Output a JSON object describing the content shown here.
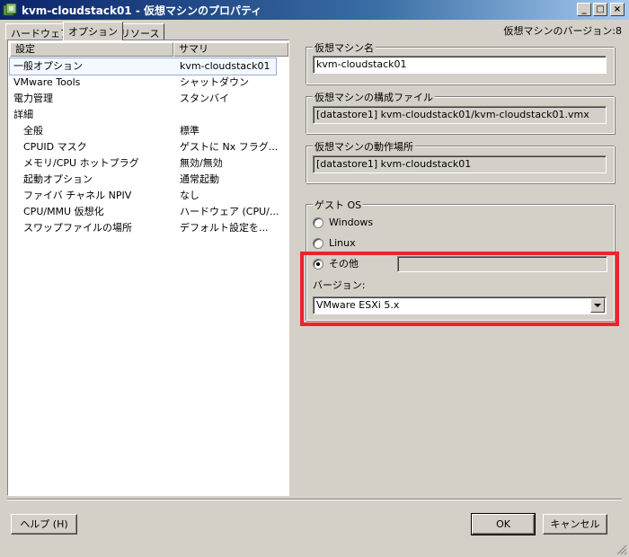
{
  "window": {
    "title": "kvm-cloudstack01 - 仮想マシンのプロパティ",
    "controls": {
      "minimize": "_",
      "maximize": "□",
      "close": "×"
    }
  },
  "tabs": [
    {
      "label": "ハードウェア",
      "active": false
    },
    {
      "label": "オプション",
      "active": true
    },
    {
      "label": "リソース",
      "active": false
    }
  ],
  "version_label": "仮想マシンのバージョン:8",
  "options_list": {
    "columns": [
      "設定",
      "サマリ"
    ],
    "items": [
      {
        "label": "一般オプション",
        "value": "kvm-cloudstack01",
        "selected": true
      },
      {
        "label": "VMware Tools",
        "value": "シャットダウン"
      },
      {
        "label": "電力管理",
        "value": "スタンバイ"
      },
      {
        "label": "詳細",
        "value": ""
      },
      {
        "label": "全般",
        "value": "標準"
      },
      {
        "label": "CPUID マスク",
        "value": "ゲストに Nx フラグ..."
      },
      {
        "label": "メモリ/CPU ホットプラグ",
        "value": "無効/無効"
      },
      {
        "label": "起動オプション",
        "value": "通常起動"
      },
      {
        "label": "ファイバ チャネル NPIV",
        "value": "なし"
      },
      {
        "label": "CPU/MMU 仮想化",
        "value": "ハードウェア (CPU/..."
      },
      {
        "label": "スワップファイルの場所",
        "value": "デフォルト設定を..."
      }
    ]
  },
  "vm_name": {
    "title": "仮想マシン名",
    "value": "kvm-cloudstack01"
  },
  "config_file": {
    "title": "仮想マシンの構成ファイル",
    "value": "[datastore1] kvm-cloudstack01/kvm-cloudstack01.vmx"
  },
  "working_location": {
    "title": "仮想マシンの動作場所",
    "value": "[datastore1] kvm-cloudstack01"
  },
  "guest_os": {
    "title": "ゲスト OS",
    "options": [
      {
        "label": "Windows",
        "checked": false
      },
      {
        "label": "Linux",
        "checked": false
      },
      {
        "label": "その他",
        "checked": true
      }
    ],
    "version_label": "バージョン:",
    "version_value": "VMware ESXi 5.x"
  },
  "buttons": {
    "help": "ヘルプ (H)",
    "ok": "OK",
    "cancel": "キャンセル"
  },
  "colors": {
    "highlight": "#e8262c",
    "titlebar": "#0a246a"
  }
}
